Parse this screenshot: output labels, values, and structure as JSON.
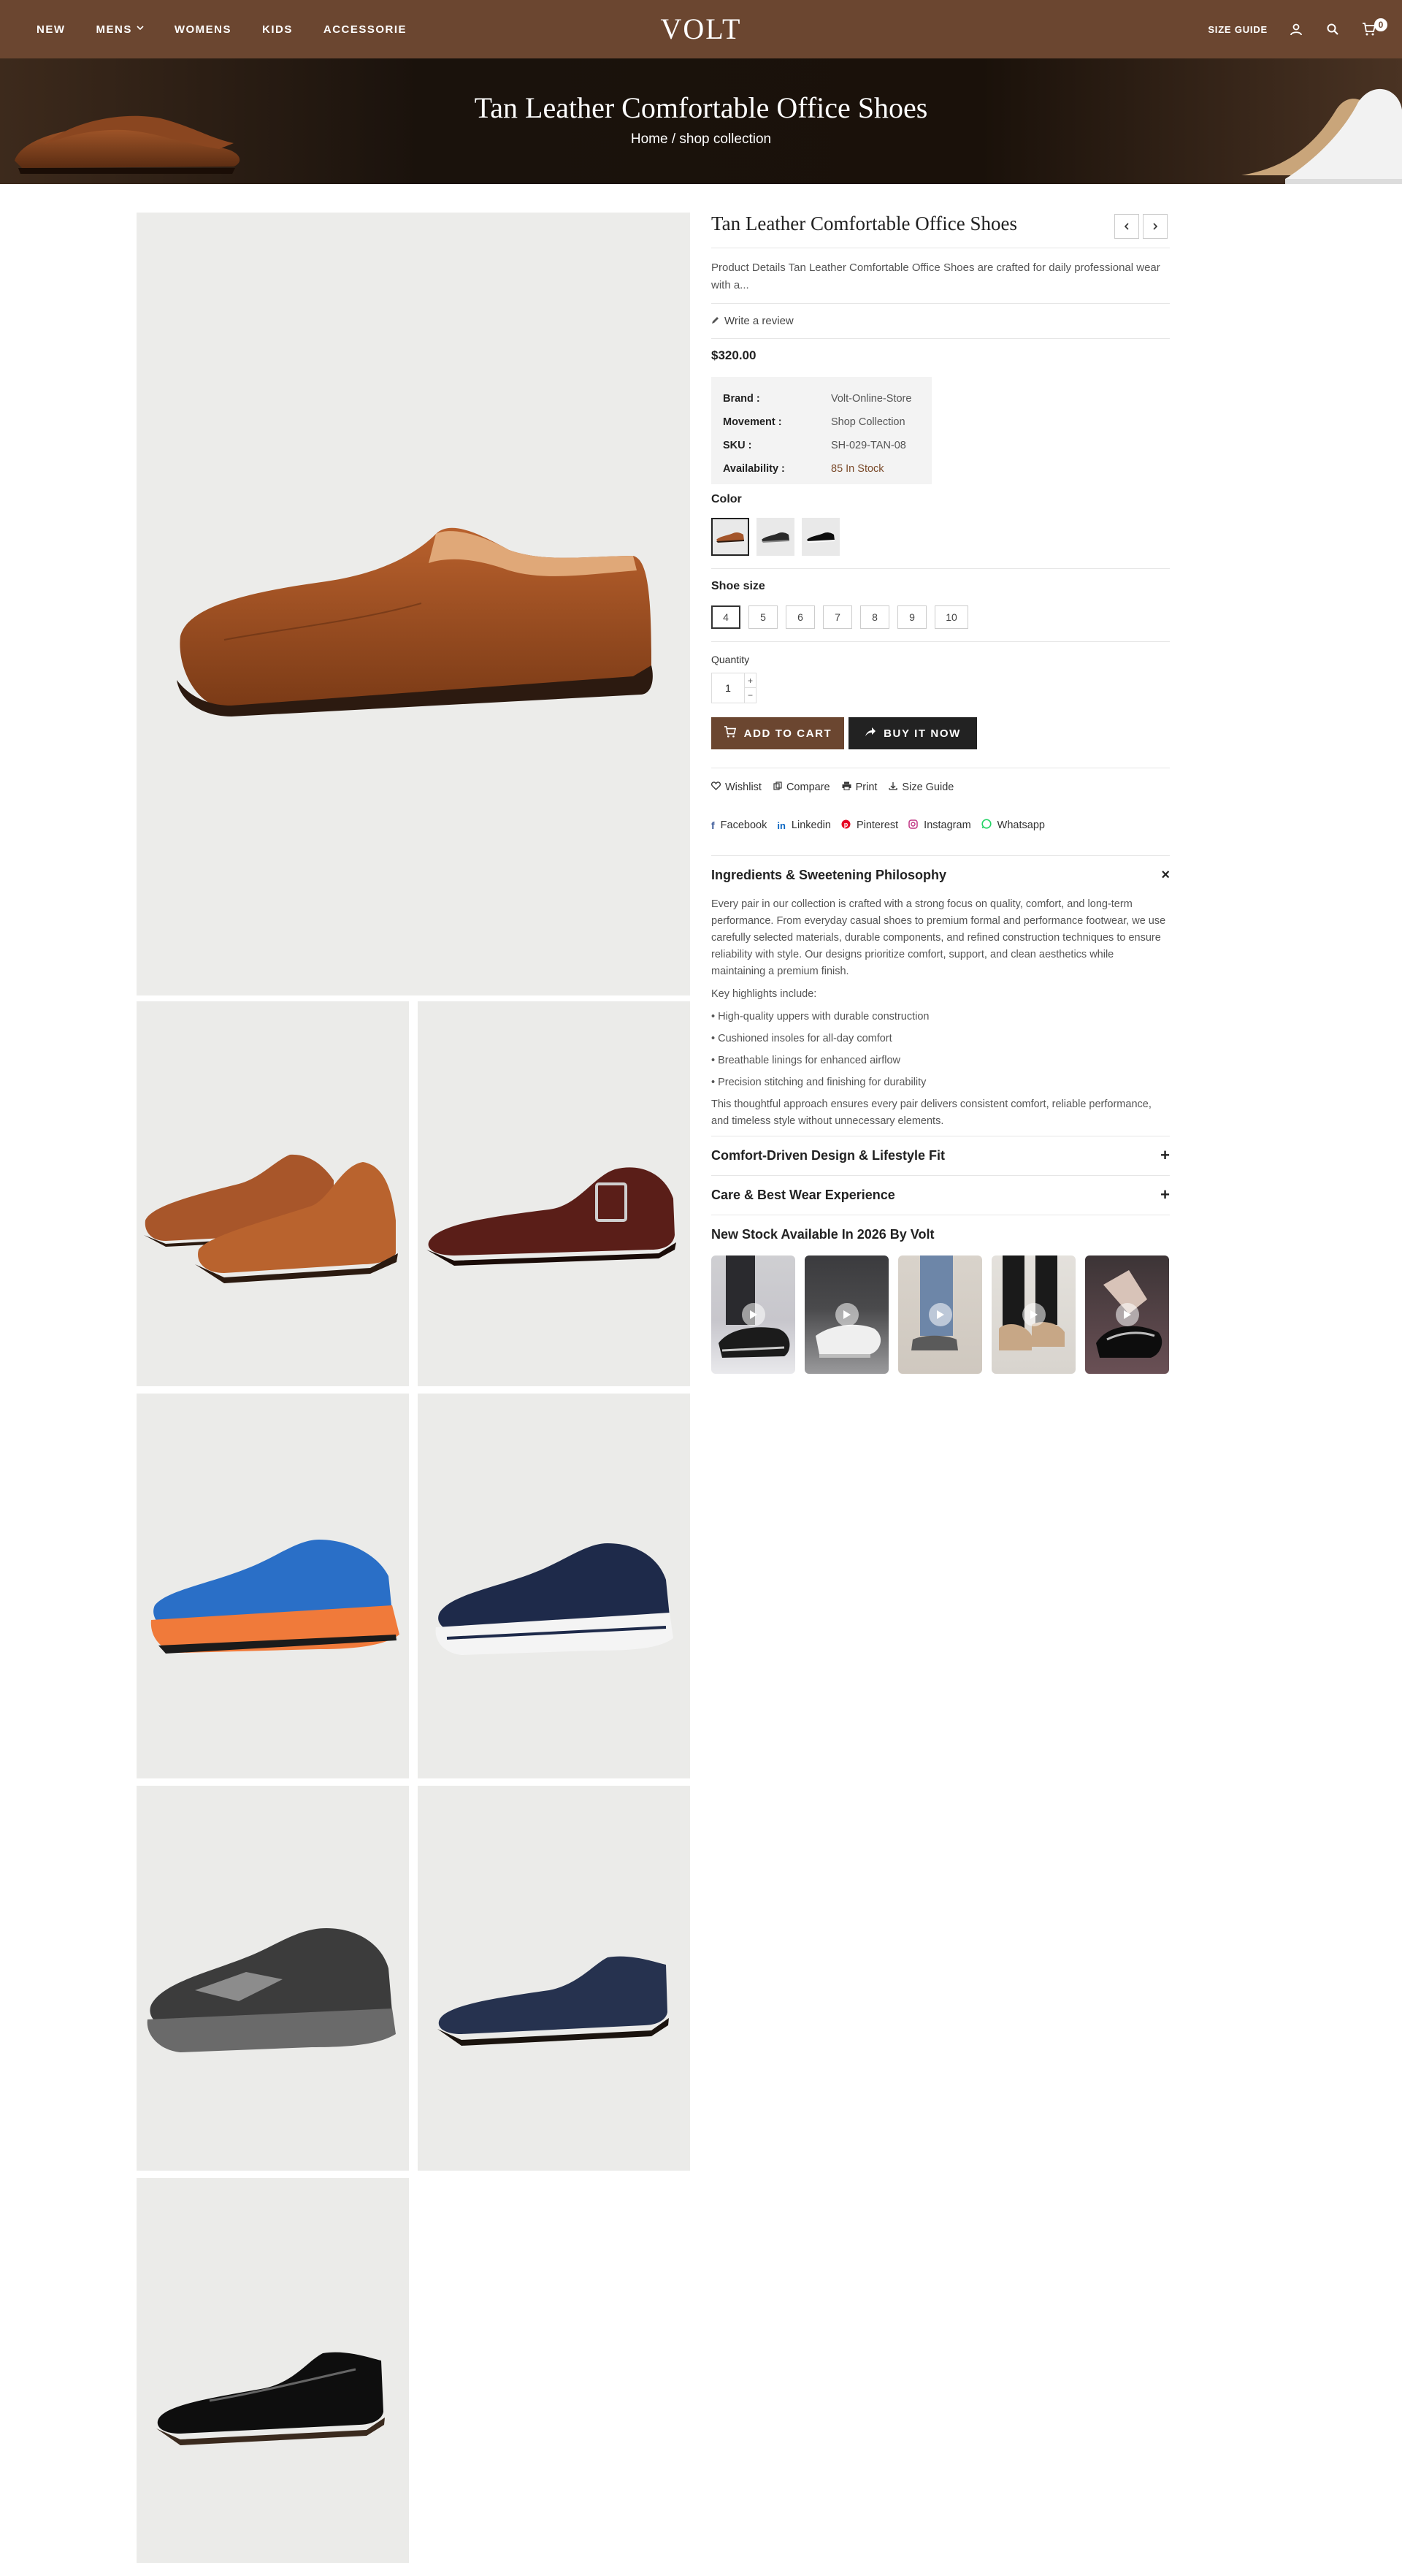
{
  "nav": {
    "items": [
      {
        "label": "NEW"
      },
      {
        "label": "MENS",
        "has_dropdown": true
      },
      {
        "label": "WOMENS"
      },
      {
        "label": "KIDS"
      },
      {
        "label": "ACCESSORIE"
      }
    ],
    "logo": "VOLT",
    "size_guide": "SIZE GUIDE",
    "cart_count": "0",
    "icons": [
      "user-icon",
      "search-icon",
      "cart-icon"
    ],
    "brand_color": "#6b4630"
  },
  "hero": {
    "title": "Tan Leather Comfortable Office Shoes",
    "breadcrumb_home": "Home",
    "breadcrumb_sep": "/",
    "breadcrumb_current": "shop collection"
  },
  "product": {
    "title": "Tan Leather Comfortable Office Shoes",
    "description": "Product Details Tan Leather Comfortable Office Shoes are crafted for daily professional wear with a...",
    "write_review": "Write a review",
    "price": "$320.00",
    "specs": [
      {
        "key": "Brand :",
        "value": "Volt-Online-Store"
      },
      {
        "key": "Movement :",
        "value": "Shop Collection"
      },
      {
        "key": "SKU :",
        "value": "SH-029-TAN-08"
      },
      {
        "key": "Availability :",
        "value": "85 In Stock"
      }
    ],
    "color_label": "Color",
    "colors": [
      "tan",
      "black-grey",
      "black-patent"
    ],
    "size_label": "Shoe size",
    "sizes": [
      "4",
      "5",
      "6",
      "7",
      "8",
      "9",
      "10"
    ],
    "selected_size": "4",
    "quantity_label": "Quantity",
    "quantity": "1",
    "qty_plus": "+",
    "qty_minus": "−",
    "add_to_cart": "ADD TO CART",
    "buy_now": "BUY IT NOW",
    "actions": [
      "Wishlist",
      "Compare",
      "Print",
      "Size Guide"
    ],
    "socials": [
      {
        "label": "Facebook",
        "color": "#3b5998"
      },
      {
        "label": "Linkedin",
        "color": "#0a66c2"
      },
      {
        "label": "Pinterest",
        "color": "#e60023"
      },
      {
        "label": "Instagram",
        "color": "#c13584"
      },
      {
        "label": "Whatsapp",
        "color": "#25d366"
      }
    ]
  },
  "accordion": {
    "open_title": "Ingredients & Sweetening Philosophy",
    "open_toggle": "×",
    "paragraph": "Every pair in our collection is crafted with a strong focus on quality, comfort, and long-term performance. From everyday casual shoes to premium formal and performance footwear, we use carefully selected materials, durable components, and refined construction techniques to ensure reliability with style. Our designs prioritize comfort, support, and clean aesthetics while maintaining a premium finish.",
    "highlights_label": "Key highlights include:",
    "highlights": [
      "• High-quality uppers with durable construction",
      "• Cushioned insoles for all-day comfort",
      "• Breathable linings for enhanced airflow",
      "• Precision stitching and finishing for durability"
    ],
    "closing": "This thoughtful approach ensures every pair delivers consistent comfort, reliable performance, and timeless style without unnecessary elements.",
    "closed": [
      {
        "title": "Comfort-Driven Design & Lifestyle Fit",
        "toggle": "+"
      },
      {
        "title": "Care & Best Wear Experience",
        "toggle": "+"
      }
    ]
  },
  "videos": {
    "title": "New Stock Available In 2026 By Volt",
    "count": 5
  }
}
